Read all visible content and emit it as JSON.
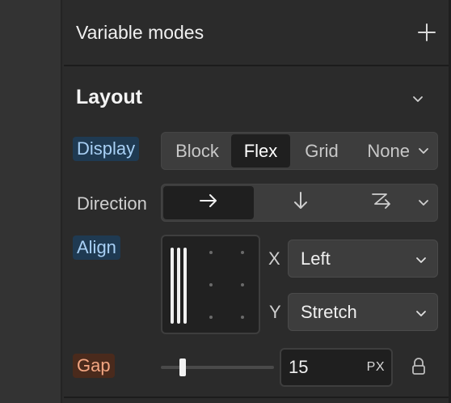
{
  "variable_modes": {
    "title": "Variable modes"
  },
  "layout": {
    "title": "Layout"
  },
  "display": {
    "label": "Display",
    "options": [
      "Block",
      "Flex",
      "Grid",
      "None"
    ],
    "selected": "Flex"
  },
  "direction": {
    "label": "Direction",
    "options": [
      "row-arrow-right-icon",
      "column-arrow-down-icon",
      "wrap-arrow-icon"
    ],
    "selected": "row-arrow-right-icon"
  },
  "align": {
    "label": "Align",
    "x_label": "X",
    "x_value": "Left",
    "y_label": "Y",
    "y_value": "Stretch"
  },
  "gap": {
    "label": "Gap",
    "value": "15",
    "unit": "PX"
  },
  "colors": {
    "panel_bg": "#2b2b2b",
    "label_blue_bg": "#1f3a52",
    "label_blue_text": "#a8d0f5",
    "label_orange_bg": "#4a2a1c",
    "label_orange_text": "#f3a682"
  }
}
